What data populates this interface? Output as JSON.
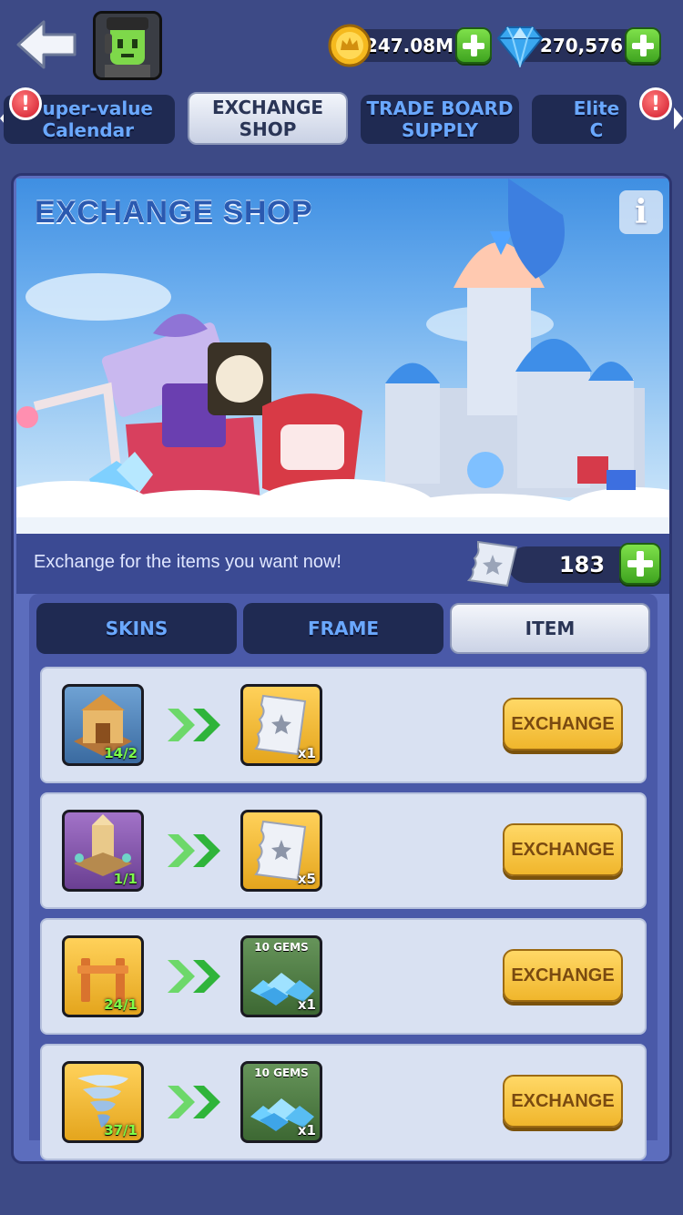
{
  "header": {
    "coins": "247.08M",
    "gems": "270,576"
  },
  "category_tabs": [
    {
      "label": "uper-value\nCalendar",
      "active": false
    },
    {
      "label": "EXCHANGE SHOP",
      "active": true
    },
    {
      "label": "TRADE BOARD\nSUPPLY",
      "active": false
    },
    {
      "label": "Elite C",
      "active": false
    }
  ],
  "badges": {
    "left": "!",
    "right": "!"
  },
  "shop": {
    "title": "EXCHANGE SHOP",
    "info_label": "i",
    "subtitle": "Exchange for the items you want now!",
    "ticket_count": "183"
  },
  "sub_tabs": [
    {
      "label": "SKINS",
      "active": false
    },
    {
      "label": "FRAME",
      "active": false
    },
    {
      "label": "ITEM",
      "active": true
    }
  ],
  "rows": [
    {
      "cost_qty": "14/2",
      "reward_qty": "x1",
      "reward_label": "",
      "button": "EXCHANGE"
    },
    {
      "cost_qty": "1/1",
      "reward_qty": "x5",
      "reward_label": "",
      "button": "EXCHANGE"
    },
    {
      "cost_qty": "24/1",
      "reward_qty": "x1",
      "reward_label": "10 GEMS",
      "button": "EXCHANGE"
    },
    {
      "cost_qty": "37/1",
      "reward_qty": "x1",
      "reward_label": "10 GEMS",
      "button": "EXCHANGE"
    }
  ],
  "colors": {
    "background": "#3d4a86",
    "panel": "#5c6dbd",
    "tab_text": "#6aa8ff",
    "exchange_button": "#f0b62c",
    "qty_green": "#7dff4a"
  }
}
